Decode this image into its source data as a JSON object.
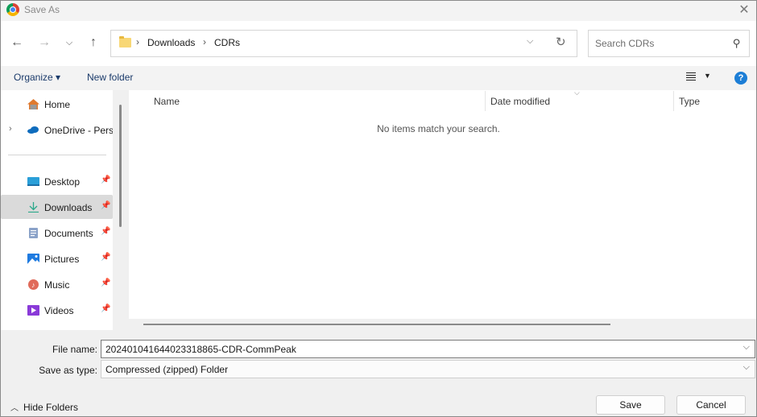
{
  "window": {
    "title": "Save As",
    "close_icon": "close-icon"
  },
  "navigation": {
    "back_icon": "arrow-left-icon",
    "forward_icon": "arrow-right-icon",
    "recent_icon": "chevron-down-icon",
    "up_icon": "arrow-up-icon",
    "breadcrumb": [
      "Downloads",
      "CDRs"
    ],
    "search_placeholder": "Search CDRs"
  },
  "toolbar": {
    "organize_label": "Organize ▾",
    "new_folder_label": "New folder",
    "help_label": "?"
  },
  "sidebar": {
    "items": [
      {
        "label": "Home",
        "icon": "home-icon",
        "pinned": false
      },
      {
        "label": "OneDrive - Perso",
        "icon": "cloud-icon",
        "pinned": false,
        "expandable": true
      },
      {
        "label": "Desktop",
        "icon": "desktop-icon",
        "pinned": true
      },
      {
        "label": "Downloads",
        "icon": "download-icon",
        "pinned": true,
        "selected": true
      },
      {
        "label": "Documents",
        "icon": "documents-icon",
        "pinned": true
      },
      {
        "label": "Pictures",
        "icon": "pictures-icon",
        "pinned": true
      },
      {
        "label": "Music",
        "icon": "music-icon",
        "pinned": true
      },
      {
        "label": "Videos",
        "icon": "videos-icon",
        "pinned": true
      }
    ]
  },
  "filelist": {
    "columns": [
      "Name",
      "Date modified",
      "Type"
    ],
    "empty_message": "No items match your search."
  },
  "form": {
    "file_name_label": "File name:",
    "file_name_value": "20240104164402331886​5-CDR-CommPeak",
    "save_type_label": "Save as type:",
    "save_type_value": "Compressed (zipped) Folder"
  },
  "footer": {
    "hide_folders_label": "Hide Folders",
    "save_label": "Save",
    "cancel_label": "Cancel"
  }
}
